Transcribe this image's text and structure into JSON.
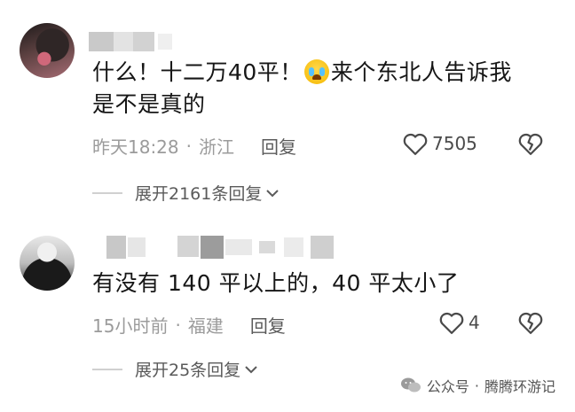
{
  "comments": [
    {
      "text_part1": "什么！十二万40平！",
      "emoji": "loudly-crying-face",
      "text_part2": "来个东北人告诉我",
      "text_line2": "是不是真的",
      "time": "昨天18:28",
      "separator": "·",
      "location": "浙江",
      "reply_label": "回复",
      "likes": "7505",
      "expand_label": "展开2161条回复"
    },
    {
      "text": "有没有 140 平以上的，40 平太小了",
      "time": "15小时前",
      "separator": "·",
      "location": "福建",
      "reply_label": "回复",
      "likes": "4",
      "expand_label": "展开25条回复"
    }
  ],
  "watermark": {
    "source": "公众号",
    "separator": "·",
    "account": "腾腾环游记"
  },
  "icons": {
    "like": "heart-outline-icon",
    "dislike": "broken-heart-icon",
    "expand": "chevron-down-icon",
    "watermark": "wechat-icon"
  },
  "colors": {
    "text": "#161616",
    "meta": "#9b9b9b",
    "accent_gray": "#5a5a5a"
  }
}
